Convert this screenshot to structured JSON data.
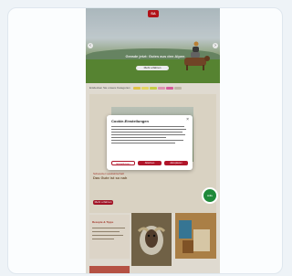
{
  "brand": {
    "logo_text": "SA",
    "color": "#c0141b"
  },
  "hero": {
    "title": "Gerade jetzt: Gutes aus den Alpen",
    "cta": "Mehr erfahren",
    "prev_icon": "chevron-left-icon",
    "next_icon": "chevron-right-icon"
  },
  "category_bar": {
    "label": "Entdecken Sie unsere Kategorien",
    "chip_colors": [
      "#f3d34a",
      "#f7e86b",
      "#d7df4a",
      "#f0a0c0",
      "#e862a8",
      "#cfc7b5"
    ]
  },
  "section": {
    "kicker": "Schweizer Landwirtschaft",
    "title": "Das Gute ist so nah",
    "button": "Mehr erfahren"
  },
  "tiles": {
    "text_tile_title": "Rezepte & Tipps"
  },
  "badge": {
    "label": "Hilfe"
  },
  "cookie_modal": {
    "title": "Cookie-Einstellungen",
    "close": "×",
    "buttons": [
      "Einstellungen",
      "Ablehnen",
      "Akzeptieren"
    ]
  }
}
